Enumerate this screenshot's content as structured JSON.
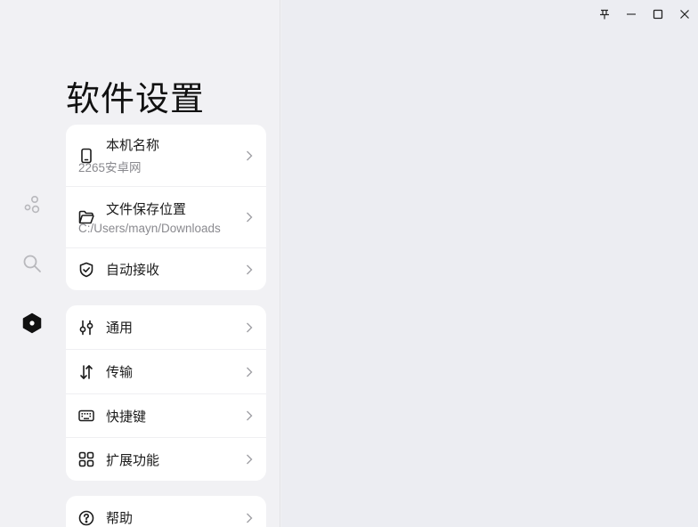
{
  "window": {
    "buttons": [
      {
        "name": "pin-icon"
      },
      {
        "name": "minimize-icon"
      },
      {
        "name": "maximize-icon"
      },
      {
        "name": "close-icon"
      }
    ]
  },
  "nav": {
    "items": [
      {
        "name": "nearby-devices-icon",
        "active": false
      },
      {
        "name": "search-icon",
        "active": false
      },
      {
        "name": "settings-icon",
        "active": true
      }
    ]
  },
  "page": {
    "title": "软件设置"
  },
  "groups": {
    "device": {
      "items": [
        {
          "icon": "phone-icon",
          "label": "本机名称",
          "value": "2265安卓网"
        },
        {
          "icon": "folder-icon",
          "label": "文件保存位置",
          "value": "C:/Users/mayn/Downloads"
        },
        {
          "icon": "shield-check-icon",
          "label": "自动接收"
        }
      ]
    },
    "general": {
      "items": [
        {
          "icon": "sliders-icon",
          "label": "通用"
        },
        {
          "icon": "transfer-icon",
          "label": "传输"
        },
        {
          "icon": "keyboard-icon",
          "label": "快捷键"
        },
        {
          "icon": "apps-grid-icon",
          "label": "扩展功能"
        }
      ]
    },
    "help": {
      "items": [
        {
          "icon": "help-circle-icon",
          "label": "帮助"
        }
      ]
    }
  },
  "colors": {
    "background": "#f1f1f4",
    "right_pane": "#ecedf2",
    "card": "#ffffff",
    "text": "#1b1b1b",
    "muted": "#8a8a8f",
    "nav_icon": "#b8b8bc",
    "nav_active": "#111111"
  }
}
